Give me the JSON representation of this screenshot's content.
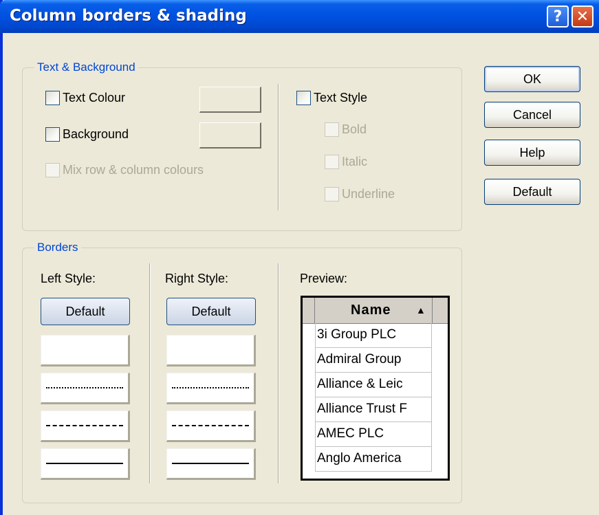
{
  "window": {
    "title": "Column borders & shading",
    "help_glyph": "?",
    "close_glyph": "✕"
  },
  "text_background": {
    "legend": "Text & Background",
    "text_colour": "Text Colour",
    "background": "Background",
    "mix_colours": "Mix row & column colours",
    "text_style": "Text Style",
    "bold": "Bold",
    "italic": "Italic",
    "underline": "Underline"
  },
  "borders": {
    "legend": "Borders",
    "left_style_label": "Left Style:",
    "right_style_label": "Right Style:",
    "preview_label": "Preview:",
    "default_label": "Default",
    "line_styles": [
      "none",
      "dotted",
      "dashed",
      "solid"
    ]
  },
  "buttons": {
    "ok": "OK",
    "cancel": "Cancel",
    "help": "Help",
    "default": "Default"
  },
  "preview": {
    "header": "Name",
    "sort_glyph": "▲",
    "rows": [
      "3i Group PLC",
      "Admiral Group",
      "Alliance & Leic",
      "Alliance Trust F",
      "AMEC PLC",
      "Anglo America"
    ]
  },
  "colors": {
    "titlebar": "#0054E3",
    "dialog_bg": "#ECE9D8",
    "legend_text": "#0046D5"
  }
}
